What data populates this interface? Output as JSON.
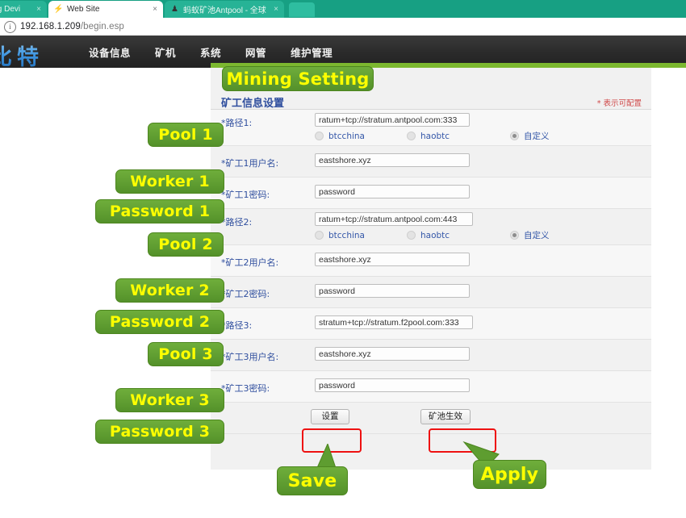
{
  "browser": {
    "tabs": [
      {
        "title": "ing Devi",
        "favicon": "",
        "active": false,
        "close_label": "×"
      },
      {
        "title": "Web Site",
        "favicon": "⚡",
        "active": true,
        "close_label": "×"
      },
      {
        "title": "蚂蚁矿池Antpool - 全球",
        "favicon": "♟",
        "active": false,
        "close_label": "×"
      }
    ],
    "url_host": "192.168.1.209",
    "url_path": "/begin.esp",
    "info_icon": "ⓘ"
  },
  "site": {
    "logo_text": "比特",
    "nav": [
      {
        "label": "设备信息"
      },
      {
        "label": "矿机"
      },
      {
        "label": "系统"
      },
      {
        "label": "网管"
      },
      {
        "label": "维护管理"
      }
    ]
  },
  "panel": {
    "heading": "矿工信息设置",
    "config_note": "* 表示可配置",
    "rows": [
      {
        "key": "pool1",
        "label": "*路径1:",
        "value": "ratum+tcp://stratum.antpool.com:333",
        "placeholder": "",
        "input_width": 192,
        "radios": [
          {
            "label": "btcchina",
            "checked": false
          },
          {
            "label": "haobtc",
            "checked": false
          },
          {
            "label": "自定义",
            "checked": true
          }
        ]
      },
      {
        "key": "worker1",
        "label": "*矿工1用户名:",
        "value": "eastshore.xyz",
        "placeholder": "",
        "input_width": 192,
        "radios": []
      },
      {
        "key": "password1",
        "label": "*矿工1密码:",
        "value": "password",
        "placeholder": "",
        "input_width": 192,
        "radios": []
      },
      {
        "key": "pool2",
        "label": "*路径2:",
        "value": "ratum+tcp://stratum.antpool.com:443",
        "placeholder": "",
        "input_width": 196,
        "radios": [
          {
            "label": "btcchina",
            "checked": false
          },
          {
            "label": "haobtc",
            "checked": false
          },
          {
            "label": "自定义",
            "checked": true
          }
        ]
      },
      {
        "key": "worker2",
        "label": "*矿工2用户名:",
        "value": "eastshore.xyz",
        "placeholder": "",
        "input_width": 192,
        "radios": []
      },
      {
        "key": "password2",
        "label": "*矿工2密码:",
        "value": "password",
        "placeholder": "",
        "input_width": 192,
        "radios": []
      },
      {
        "key": "pool3",
        "label": "*路径3:",
        "value": "stratum+tcp://stratum.f2pool.com:333",
        "placeholder": "",
        "input_width": 196,
        "radios": []
      },
      {
        "key": "worker3",
        "label": "*矿工3用户名:",
        "value": "eastshore.xyz",
        "placeholder": "",
        "input_width": 192,
        "radios": []
      },
      {
        "key": "password3",
        "label": "*矿工3密码:",
        "value": "password",
        "placeholder": "",
        "input_width": 192,
        "radios": []
      }
    ],
    "buttons": {
      "save": "设置",
      "apply": "矿池生效"
    }
  },
  "annotations": {
    "title": "Mining Setting",
    "pool1": "Pool 1",
    "worker1": "Worker 1",
    "password1": "Password 1",
    "pool2": "Pool 2",
    "worker2": "Worker 2",
    "password2": "Password 2",
    "pool3": "Pool 3",
    "worker3": "Worker 3",
    "password3": "Password 3",
    "save": "Save",
    "apply": "Apply"
  },
  "colors": {
    "callout_green": "#5e9d30",
    "callout_text": "#ffff00",
    "highlight_red": "#ee1111",
    "browser_teal": "#17a083",
    "accent_green": "#7cb82f",
    "label_blue": "#2f4e9e"
  }
}
